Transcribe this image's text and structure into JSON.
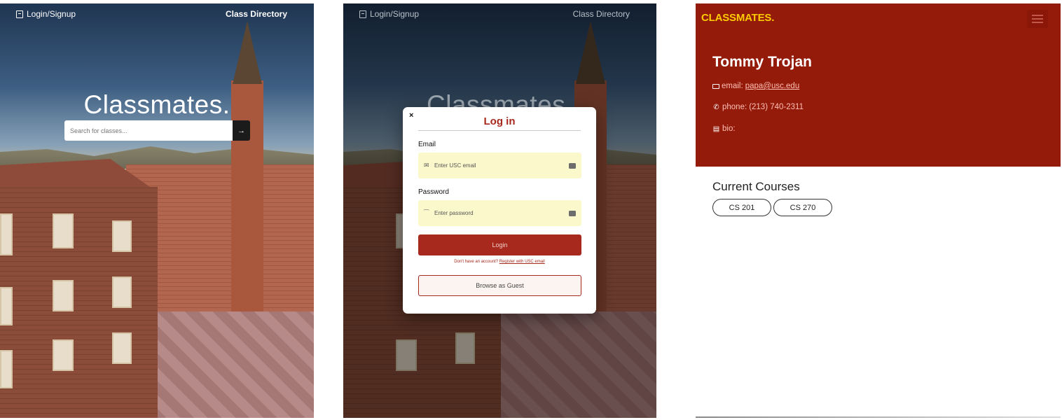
{
  "home": {
    "nav": {
      "login_label": "Login/Signup",
      "directory_label": "Class Directory"
    },
    "title": "Classmates.",
    "search": {
      "placeholder": "Search for classes...",
      "button_glyph": "→"
    }
  },
  "login_modal": {
    "close_glyph": "×",
    "title": "Log in",
    "email_label": "Email",
    "email_placeholder": "Enter USC email",
    "password_label": "Password",
    "password_placeholder": "Enter password",
    "login_button": "Login",
    "register_prompt": "Don't have an account?",
    "register_link": "Register with USC email",
    "guest_button": "Browse as Guest"
  },
  "profile": {
    "brand": "CLASSMATES.",
    "name": "Tommy Trojan",
    "email_label": "email:",
    "email_value": "papa@usc.edu",
    "phone_label": "phone:",
    "phone_value": "(213) 740-2311",
    "bio_label": "bio:",
    "courses_title": "Current Courses",
    "courses": [
      "CS 201",
      "CS 270"
    ]
  },
  "colors": {
    "cardinal": "#941a0a",
    "gold": "#ffcc00",
    "login_red": "#a7281c",
    "field_bg": "#fbf8cc"
  },
  "icons": [
    "login-icon",
    "arrow-right-icon",
    "close-icon",
    "envelope-icon",
    "key-icon",
    "keyboard-icon",
    "hamburger-menu-icon",
    "phone-icon",
    "clipboard-icon"
  ]
}
